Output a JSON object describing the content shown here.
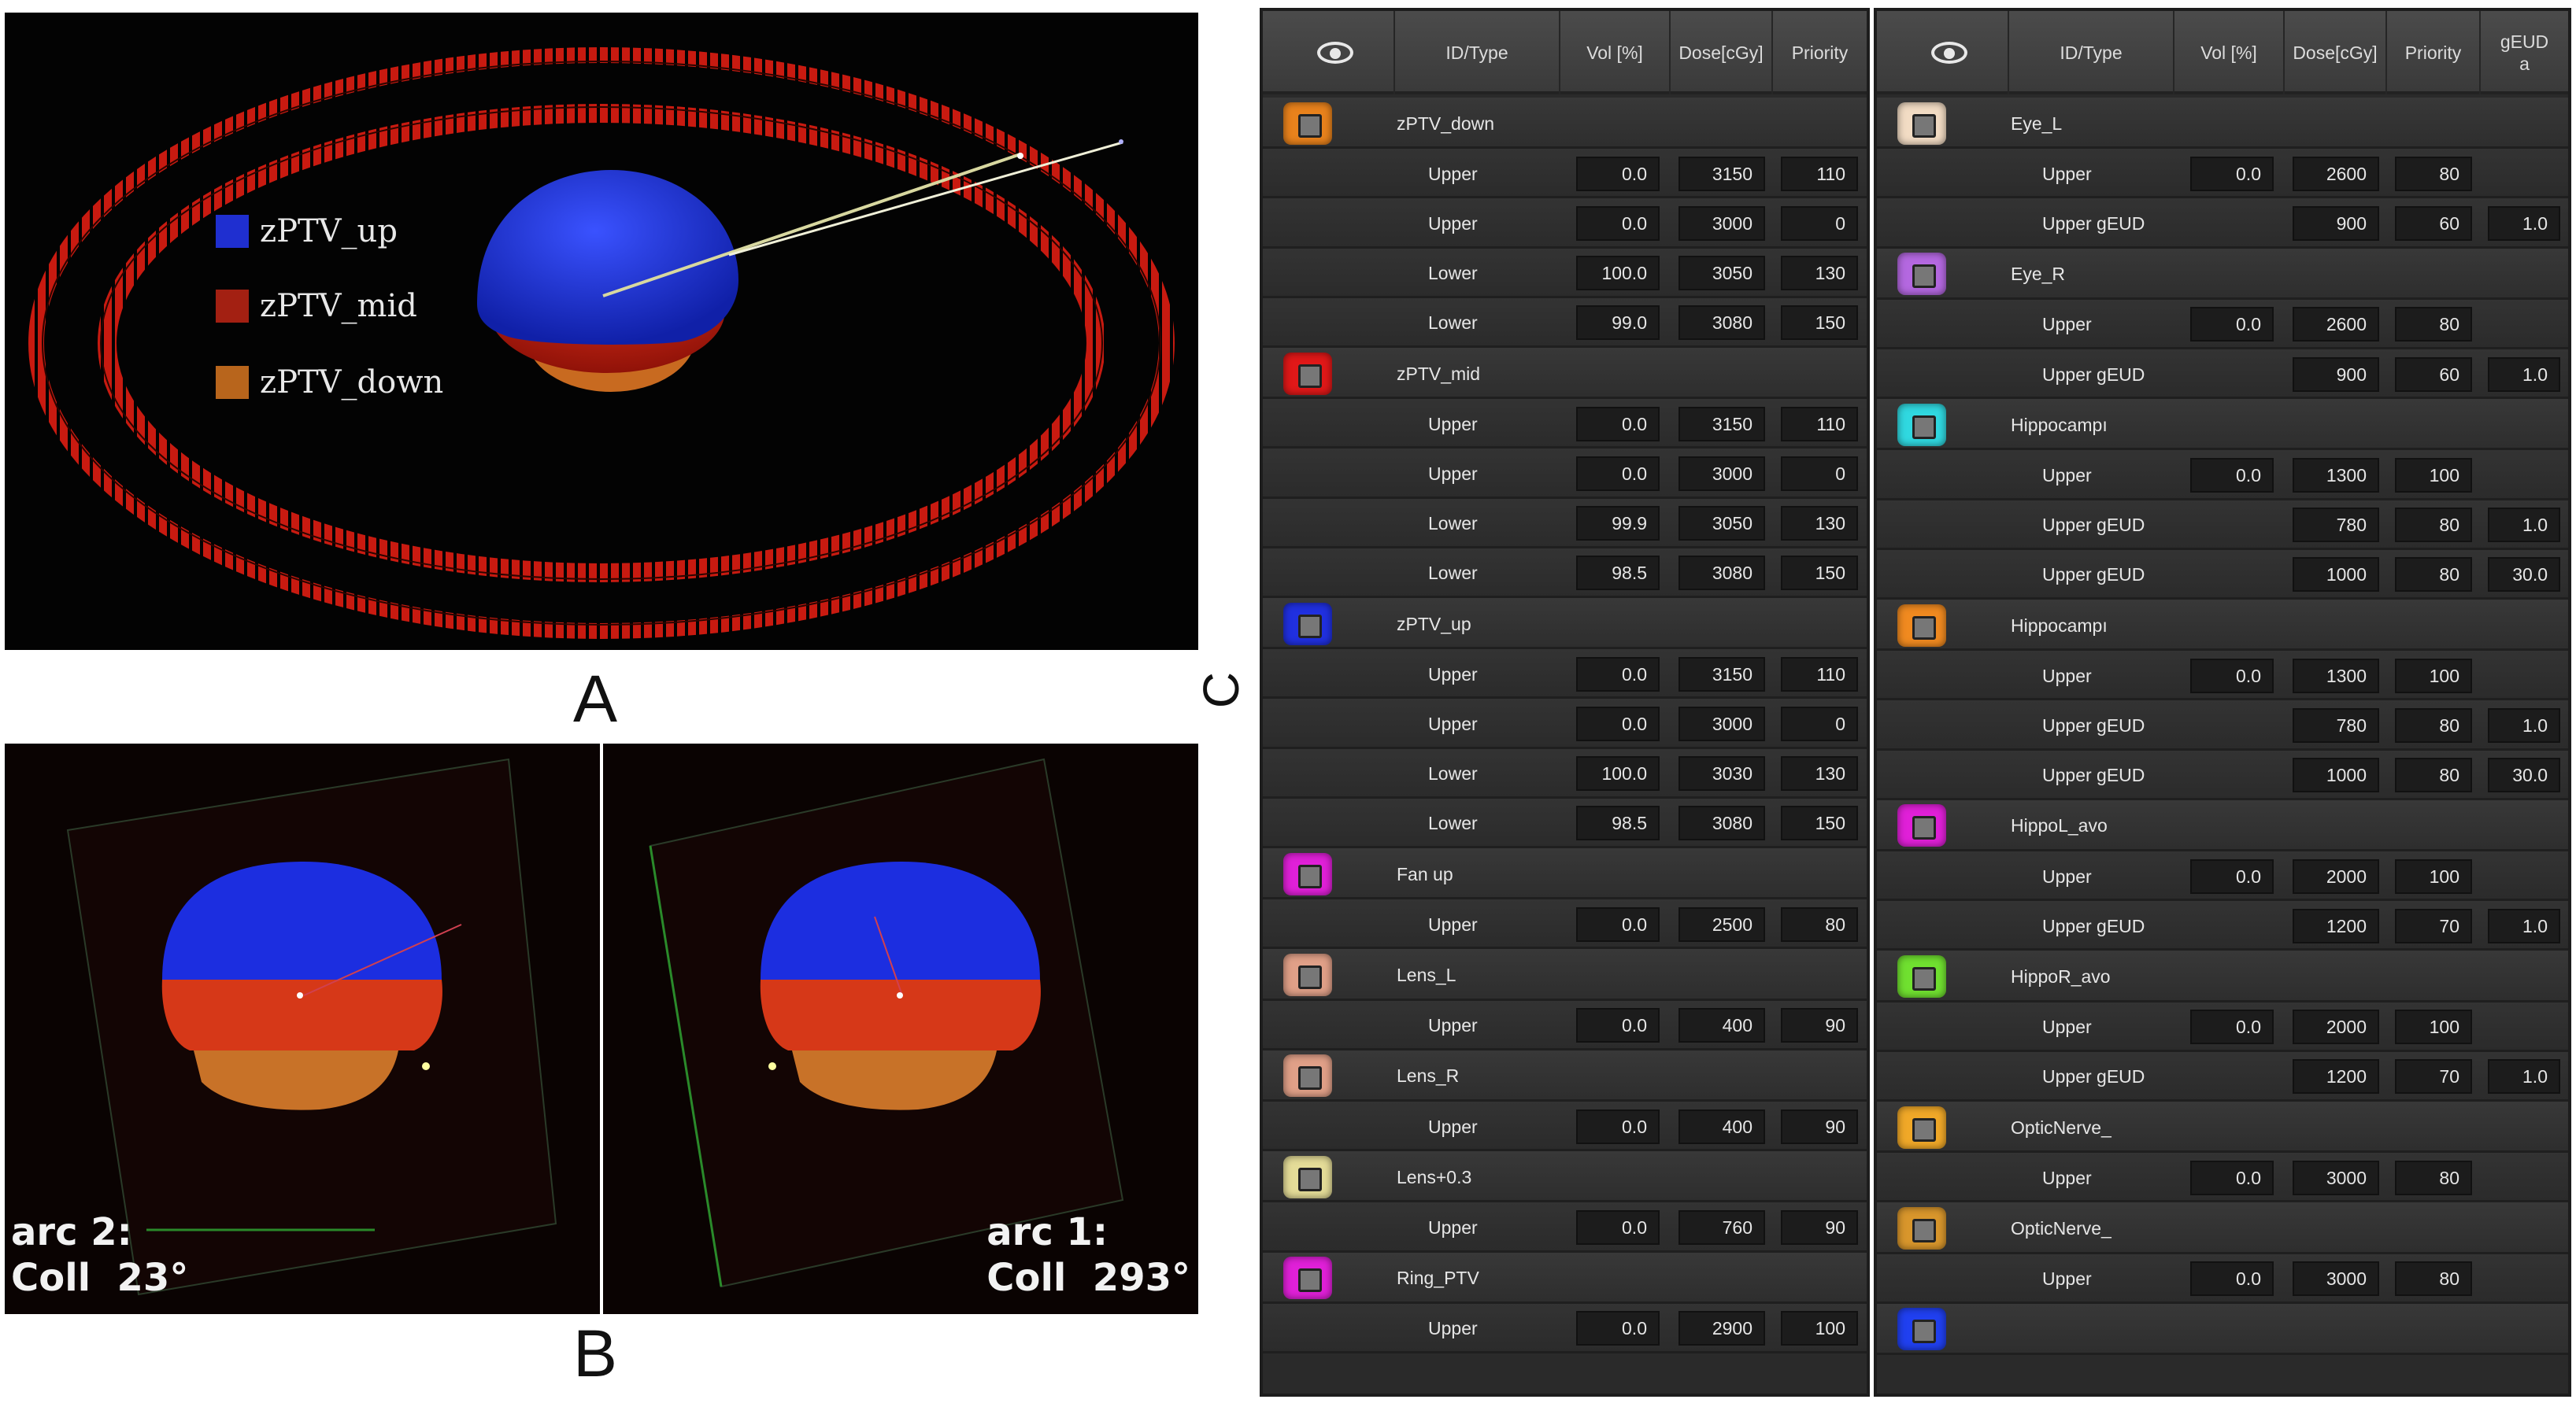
{
  "colors": {
    "ptv_up": "#1e3ad8",
    "ptv_mid": "#b81e10",
    "ptv_down": "#c26a18",
    "ring": "#c81a10"
  },
  "panel_labels": {
    "a": "A",
    "b": "B",
    "c": "C"
  },
  "panel_a": {
    "legend": [
      {
        "label": "zPTV_up",
        "color": "#1f2fd0"
      },
      {
        "label": "zPTV_mid",
        "color": "#a32012"
      },
      {
        "label": "zPTV_down",
        "color": "#b8651c"
      }
    ]
  },
  "panel_b": {
    "left": {
      "line1": "arc 2:",
      "line2": "Coll  23°"
    },
    "right": {
      "line1": "arc 1:",
      "line2": "Coll  293°"
    }
  },
  "table_left": {
    "headers": {
      "id_type": "ID/Type",
      "vol": "Vol [%]",
      "dose": "Dose[cGy]",
      "priority": "Priority"
    },
    "rows": [
      {
        "kind": "s",
        "name": "zPTV_down",
        "color": "#e8821c"
      },
      {
        "kind": "c",
        "type": "Upper",
        "vol": "0.0",
        "dose": "3150",
        "pri": "110"
      },
      {
        "kind": "c",
        "type": "Upper",
        "vol": "0.0",
        "dose": "3000",
        "pri": "0"
      },
      {
        "kind": "c",
        "type": "Lower",
        "vol": "100.0",
        "dose": "3050",
        "pri": "130"
      },
      {
        "kind": "c",
        "type": "Lower",
        "vol": "99.0",
        "dose": "3080",
        "pri": "150"
      },
      {
        "kind": "s",
        "name": "zPTV_mid",
        "color": "#e01818"
      },
      {
        "kind": "c",
        "type": "Upper",
        "vol": "0.0",
        "dose": "3150",
        "pri": "110"
      },
      {
        "kind": "c",
        "type": "Upper",
        "vol": "0.0",
        "dose": "3000",
        "pri": "0"
      },
      {
        "kind": "c",
        "type": "Lower",
        "vol": "99.9",
        "dose": "3050",
        "pri": "130"
      },
      {
        "kind": "c",
        "type": "Lower",
        "vol": "98.5",
        "dose": "3080",
        "pri": "150"
      },
      {
        "kind": "s",
        "name": "zPTV_up",
        "color": "#2030e0"
      },
      {
        "kind": "c",
        "type": "Upper",
        "vol": "0.0",
        "dose": "3150",
        "pri": "110"
      },
      {
        "kind": "c",
        "type": "Upper",
        "vol": "0.0",
        "dose": "3000",
        "pri": "0"
      },
      {
        "kind": "c",
        "type": "Lower",
        "vol": "100.0",
        "dose": "3030",
        "pri": "130"
      },
      {
        "kind": "c",
        "type": "Lower",
        "vol": "98.5",
        "dose": "3080",
        "pri": "150"
      },
      {
        "kind": "s",
        "name": "Fan up",
        "color": "#e020d8"
      },
      {
        "kind": "c",
        "type": "Upper",
        "vol": "0.0",
        "dose": "2500",
        "pri": "80"
      },
      {
        "kind": "s",
        "name": "Lens_L",
        "color": "#e0a088"
      },
      {
        "kind": "c",
        "type": "Upper",
        "vol": "0.0",
        "dose": "400",
        "pri": "90"
      },
      {
        "kind": "s",
        "name": "Lens_R",
        "color": "#e0a088"
      },
      {
        "kind": "c",
        "type": "Upper",
        "vol": "0.0",
        "dose": "400",
        "pri": "90"
      },
      {
        "kind": "s",
        "name": "Lens+0.3",
        "color": "#e4dc98"
      },
      {
        "kind": "c",
        "type": "Upper",
        "vol": "0.0",
        "dose": "760",
        "pri": "90"
      },
      {
        "kind": "s",
        "name": "Ring_PTV",
        "color": "#e020d8"
      },
      {
        "kind": "c",
        "type": "Upper",
        "vol": "0.0",
        "dose": "2900",
        "pri": "100"
      }
    ]
  },
  "table_right": {
    "headers": {
      "id_type": "ID/Type",
      "vol": "Vol [%]",
      "dose": "Dose[cGy]",
      "priority": "Priority",
      "geud": "gEUD\na"
    },
    "rows": [
      {
        "kind": "s",
        "name": "Eye_L",
        "color": "#f2dcc4"
      },
      {
        "kind": "c",
        "type": "Upper",
        "vol": "0.0",
        "dose": "2600",
        "pri": "80",
        "a": ""
      },
      {
        "kind": "c",
        "type": "Upper gEUD",
        "vol": "",
        "dose": "900",
        "pri": "60",
        "a": "1.0"
      },
      {
        "kind": "s",
        "name": "Eye_R",
        "color": "#b468e0"
      },
      {
        "kind": "c",
        "type": "Upper",
        "vol": "0.0",
        "dose": "2600",
        "pri": "80",
        "a": ""
      },
      {
        "kind": "c",
        "type": "Upper gEUD",
        "vol": "",
        "dose": "900",
        "pri": "60",
        "a": "1.0"
      },
      {
        "kind": "s",
        "name": "Hippocampı",
        "color": "#30d8e0"
      },
      {
        "kind": "c",
        "type": "Upper",
        "vol": "0.0",
        "dose": "1300",
        "pri": "100",
        "a": ""
      },
      {
        "kind": "c",
        "type": "Upper gEUD",
        "vol": "",
        "dose": "780",
        "pri": "80",
        "a": "1.0"
      },
      {
        "kind": "c",
        "type": "Upper gEUD",
        "vol": "",
        "dose": "1000",
        "pri": "80",
        "a": "30.0"
      },
      {
        "kind": "s",
        "name": "Hippocampı",
        "color": "#f08a20"
      },
      {
        "kind": "c",
        "type": "Upper",
        "vol": "0.0",
        "dose": "1300",
        "pri": "100",
        "a": ""
      },
      {
        "kind": "c",
        "type": "Upper gEUD",
        "vol": "",
        "dose": "780",
        "pri": "80",
        "a": "1.0"
      },
      {
        "kind": "c",
        "type": "Upper gEUD",
        "vol": "",
        "dose": "1000",
        "pri": "80",
        "a": "30.0"
      },
      {
        "kind": "s",
        "name": "HippoL_avo",
        "color": "#e020d8"
      },
      {
        "kind": "c",
        "type": "Upper",
        "vol": "0.0",
        "dose": "2000",
        "pri": "100",
        "a": ""
      },
      {
        "kind": "c",
        "type": "Upper gEUD",
        "vol": "",
        "dose": "1200",
        "pri": "70",
        "a": "1.0"
      },
      {
        "kind": "s",
        "name": "HippoR_avo",
        "color": "#70e030"
      },
      {
        "kind": "c",
        "type": "Upper",
        "vol": "0.0",
        "dose": "2000",
        "pri": "100",
        "a": ""
      },
      {
        "kind": "c",
        "type": "Upper gEUD",
        "vol": "",
        "dose": "1200",
        "pri": "70",
        "a": "1.0"
      },
      {
        "kind": "s",
        "name": "OpticNerve_",
        "color": "#f0a828"
      },
      {
        "kind": "c",
        "type": "Upper",
        "vol": "0.0",
        "dose": "3000",
        "pri": "80",
        "a": ""
      },
      {
        "kind": "s",
        "name": "OpticNerve_",
        "color": "#d8962c"
      },
      {
        "kind": "c",
        "type": "Upper",
        "vol": "0.0",
        "dose": "3000",
        "pri": "80",
        "a": ""
      },
      {
        "kind": "s",
        "name": "",
        "color": "#2040f0"
      }
    ]
  }
}
